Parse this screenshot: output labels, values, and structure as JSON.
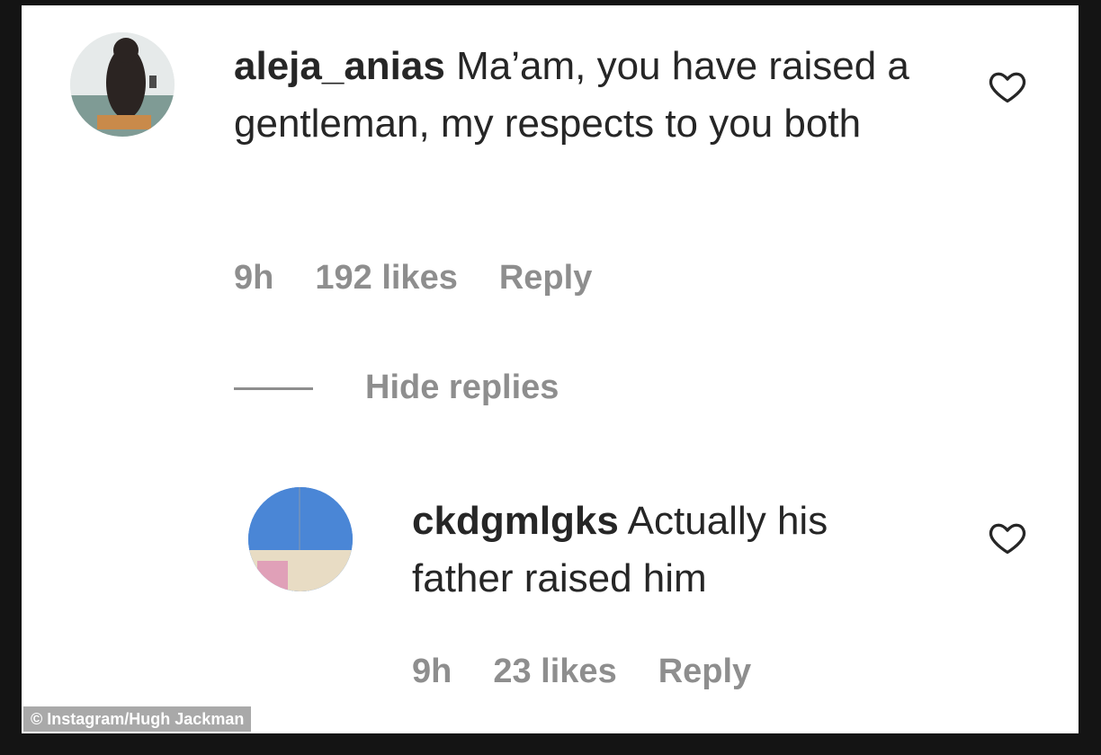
{
  "comments": [
    {
      "username": "aleja_anias",
      "text": "Ma’am, you have raised a gentleman, my respects to you both",
      "time": "9h",
      "likes": "192 likes",
      "reply_label": "Reply",
      "avatar": "photo-of-person-avatar"
    },
    {
      "username": "ckdgmlgks",
      "text": "Actually his father raised him",
      "time": "9h",
      "likes": "23 likes",
      "reply_label": "Reply",
      "avatar": "sky-building-avatar"
    }
  ],
  "thread": {
    "hide_replies_label": "Hide replies"
  },
  "credit": "© Instagram/Hugh Jackman",
  "icons": {
    "like": "heart-icon"
  },
  "colors": {
    "text": "#262626",
    "meta": "#8e8e8e",
    "avatar2_sky": "#4a86d6"
  }
}
